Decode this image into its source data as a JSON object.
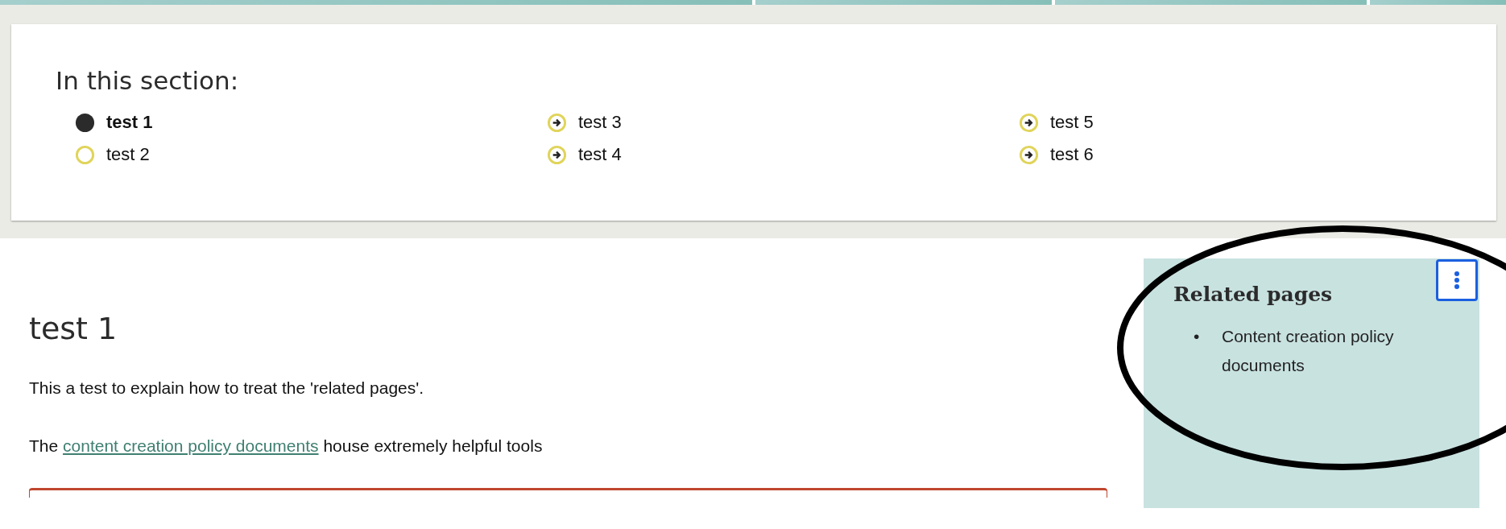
{
  "section_nav": {
    "heading": "In this section:",
    "items": [
      {
        "label": "test 1",
        "kind": "circle",
        "selected": true
      },
      {
        "label": "test 2",
        "kind": "circle",
        "selected": false
      },
      {
        "label": "test 3",
        "kind": "arrow",
        "selected": false
      },
      {
        "label": "test 4",
        "kind": "arrow",
        "selected": false
      },
      {
        "label": "test 5",
        "kind": "arrow",
        "selected": false
      },
      {
        "label": "test 6",
        "kind": "arrow",
        "selected": false
      }
    ]
  },
  "article": {
    "title": "test 1",
    "paragraphs": [
      {
        "text": "This a test to explain how to treat the 'related pages'."
      },
      {
        "text": "The",
        "link": "content creation policy documents",
        "after": "house extremely helpful tools"
      }
    ]
  },
  "related": {
    "heading": "Related pages",
    "items": [
      {
        "bullet": "•",
        "text": "Content creation policy documents"
      }
    ]
  }
}
